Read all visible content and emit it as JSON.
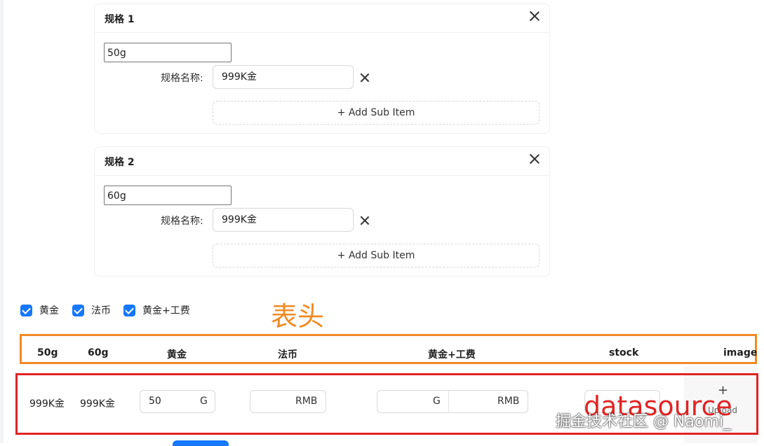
{
  "cards": [
    {
      "title": "规格 1",
      "raw_value": "50g",
      "sub_label": "规格名称:",
      "sub_value": "999K金",
      "add_label": "+ Add Sub Item"
    },
    {
      "title": "规格 2",
      "raw_value": "60g",
      "sub_label": "规格名称:",
      "sub_value": "999K金",
      "add_label": "+ Add Sub Item"
    }
  ],
  "checkboxes": [
    {
      "label": "黄金",
      "checked": true
    },
    {
      "label": "法币",
      "checked": true
    },
    {
      "label": "黄金+工费",
      "checked": true
    }
  ],
  "annotations": {
    "header_note": "表头",
    "data_note": "datasource"
  },
  "table": {
    "columns": [
      "50g",
      "60g",
      "黄金",
      "法币",
      "黄金+工费",
      "stock",
      "image"
    ],
    "row": {
      "c1": "999K金",
      "c2": "999K金",
      "gold_value": "50",
      "gold_suffix": "G",
      "fiat_suffix": "RMB",
      "mix_suffix_g": "G",
      "mix_suffix_rmb": "RMB",
      "upload_plus": "+",
      "upload_label": "Upload"
    }
  },
  "watermark": "掘金技术社区 @ Naomi_",
  "colors": {
    "accent": "#1677ff",
    "header_frame": "#f08a24",
    "data_frame": "#e02424"
  }
}
